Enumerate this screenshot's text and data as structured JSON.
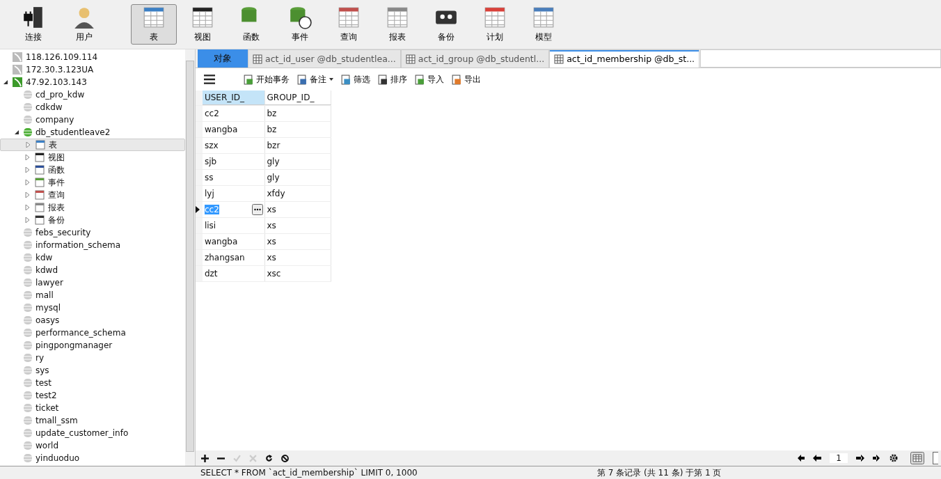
{
  "toolbar": [
    {
      "label": "连接",
      "kind": "connect",
      "selected": false
    },
    {
      "label": "用户",
      "kind": "user",
      "selected": false
    },
    {
      "label": "表",
      "kind": "table",
      "selected": true
    },
    {
      "label": "视图",
      "kind": "view",
      "selected": false
    },
    {
      "label": "函数",
      "kind": "function",
      "selected": false
    },
    {
      "label": "事件",
      "kind": "event",
      "selected": false
    },
    {
      "label": "查询",
      "kind": "query",
      "selected": false
    },
    {
      "label": "报表",
      "kind": "report",
      "selected": false
    },
    {
      "label": "备份",
      "kind": "backup",
      "selected": false
    },
    {
      "label": "计划",
      "kind": "schedule",
      "selected": false
    },
    {
      "label": "模型",
      "kind": "model",
      "selected": false
    }
  ],
  "tree": [
    {
      "label": "118.126.109.114",
      "kind": "server",
      "active": false,
      "selected": false
    },
    {
      "label": "172.30.3.123UA",
      "kind": "server",
      "active": false,
      "selected": false
    },
    {
      "label": "47.92.103.143",
      "kind": "server",
      "active": true,
      "expanded": true,
      "selected": false,
      "children": [
        {
          "label": "cd_pro_kdw",
          "kind": "db",
          "active": false,
          "selected": false
        },
        {
          "label": "cdkdw",
          "kind": "db",
          "active": false,
          "selected": false
        },
        {
          "label": "company",
          "kind": "db",
          "active": false,
          "selected": false
        },
        {
          "label": "db_studentleave2",
          "kind": "db",
          "active": true,
          "expanded": true,
          "selected": false,
          "children": [
            {
              "label": "表",
              "kind": "table",
              "expanded": false,
              "selected": true
            },
            {
              "label": "视图",
              "kind": "view",
              "expanded": false,
              "selected": false
            },
            {
              "label": "函数",
              "kind": "function",
              "expanded": false,
              "selected": false
            },
            {
              "label": "事件",
              "kind": "event",
              "expanded": false,
              "selected": false
            },
            {
              "label": "查询",
              "kind": "query",
              "expanded": false,
              "selected": false
            },
            {
              "label": "报表",
              "kind": "report",
              "expanded": false,
              "selected": false
            },
            {
              "label": "备份",
              "kind": "backup",
              "expanded": false,
              "selected": false
            }
          ]
        },
        {
          "label": "febs_security",
          "kind": "db",
          "active": false,
          "selected": false
        },
        {
          "label": "information_schema",
          "kind": "db",
          "active": false,
          "selected": false
        },
        {
          "label": "kdw",
          "kind": "db",
          "active": false,
          "selected": false
        },
        {
          "label": "kdwd",
          "kind": "db",
          "active": false,
          "selected": false
        },
        {
          "label": "lawyer",
          "kind": "db",
          "active": false,
          "selected": false
        },
        {
          "label": "mall",
          "kind": "db",
          "active": false,
          "selected": false
        },
        {
          "label": "mysql",
          "kind": "db",
          "active": false,
          "selected": false
        },
        {
          "label": "oasys",
          "kind": "db",
          "active": false,
          "selected": false
        },
        {
          "label": "performance_schema",
          "kind": "db",
          "active": false,
          "selected": false
        },
        {
          "label": "pingpongmanager",
          "kind": "db",
          "active": false,
          "selected": false
        },
        {
          "label": "ry",
          "kind": "db",
          "active": false,
          "selected": false
        },
        {
          "label": "sys",
          "kind": "db",
          "active": false,
          "selected": false
        },
        {
          "label": "test",
          "kind": "db",
          "active": false,
          "selected": false
        },
        {
          "label": "test2",
          "kind": "db",
          "active": false,
          "selected": false
        },
        {
          "label": "ticket",
          "kind": "db",
          "active": false,
          "selected": false
        },
        {
          "label": "tmall_ssm",
          "kind": "db",
          "active": false,
          "selected": false
        },
        {
          "label": "update_customer_info",
          "kind": "db",
          "active": false,
          "selected": false
        },
        {
          "label": "world",
          "kind": "db",
          "active": false,
          "selected": false
        },
        {
          "label": "yinduoduo",
          "kind": "db",
          "active": false,
          "selected": false
        }
      ]
    }
  ],
  "tabs": [
    {
      "label": "对象",
      "kind": "objects",
      "selected": false
    },
    {
      "label": "act_id_user @db_studentlea...",
      "kind": "table",
      "selected": false
    },
    {
      "label": "act_id_group @db_studentl...",
      "kind": "table",
      "selected": false
    },
    {
      "label": "act_id_membership @db_st...",
      "kind": "table",
      "selected": true
    }
  ],
  "actions": [
    {
      "label": "开始事务",
      "kind": "transaction"
    },
    {
      "label": "备注",
      "kind": "memo"
    },
    {
      "label": "筛选",
      "kind": "filter"
    },
    {
      "label": "排序",
      "kind": "sort"
    },
    {
      "label": "导入",
      "kind": "import"
    },
    {
      "label": "导出",
      "kind": "export"
    }
  ],
  "table": {
    "columns": [
      "USER_ID_",
      "GROUP_ID_"
    ],
    "rows": [
      {
        "cells": [
          "cc2",
          "bz"
        ],
        "selected": false
      },
      {
        "cells": [
          "wangba",
          "bz"
        ],
        "selected": false
      },
      {
        "cells": [
          "szx",
          "bzr"
        ],
        "selected": false
      },
      {
        "cells": [
          "sjb",
          "gly"
        ],
        "selected": false
      },
      {
        "cells": [
          "ss",
          "gly"
        ],
        "selected": false
      },
      {
        "cells": [
          "lyj",
          "xfdy"
        ],
        "selected": false
      },
      {
        "cells": [
          "cc2",
          "xs"
        ],
        "selected": true
      },
      {
        "cells": [
          "lisi",
          "xs"
        ],
        "selected": false
      },
      {
        "cells": [
          "wangba",
          "xs"
        ],
        "selected": false
      },
      {
        "cells": [
          "zhangsan",
          "xs"
        ],
        "selected": false
      },
      {
        "cells": [
          "dzt",
          "xsc"
        ],
        "selected": false
      }
    ]
  },
  "pager": {
    "page": "1"
  },
  "status_bar": {
    "query": "SELECT * FROM `act_id_membership` LIMIT 0, 1000",
    "record": "第 7 条记录 (共 11 条) 于第 1 页"
  }
}
